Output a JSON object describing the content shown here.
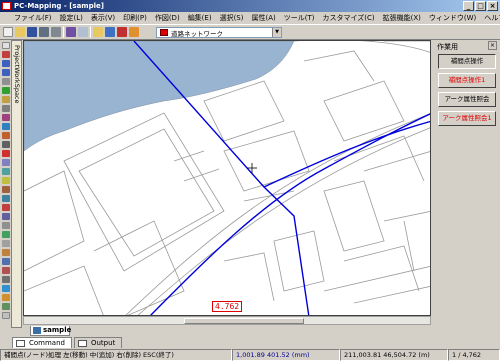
{
  "window": {
    "title": "PC-Mapping - [sample]"
  },
  "menu": [
    "ファイル(F)",
    "設定(L)",
    "表示(V)",
    "印刷(P)",
    "作図(D)",
    "編集(E)",
    "選択(S)",
    "属性(A)",
    "ツール(T)",
    "カスタマイズ(C)",
    "拡張機能(X)",
    "ウィンドウ(W)",
    "ヘルプ(H)"
  ],
  "toolbar": {
    "layer_combo_value": "道路ネットワーク"
  },
  "side_tab": {
    "label": "ProjectWorkSpace"
  },
  "panel": {
    "title": "作業用",
    "buttons": [
      "補間点操作",
      "補間点操作1",
      "アーク属性照会",
      "アーク属性照会1"
    ]
  },
  "map": {
    "measure_label": "4.762"
  },
  "document_tab": {
    "label": "sample"
  },
  "bottom_tabs": [
    "Command",
    "Output"
  ],
  "status": {
    "mode": "補間点(ノード)処理  左(移動) 中(追加) 右(削除)  ESC(終了)",
    "coord1": "1,001.89 401.52 (mm)",
    "coord2": "211,003.81 46,504.72 (m)",
    "page": "1 / 4,762"
  },
  "colors": {
    "water": "#99b4d1",
    "road": "#0000dd",
    "measure": "#dd0000"
  }
}
